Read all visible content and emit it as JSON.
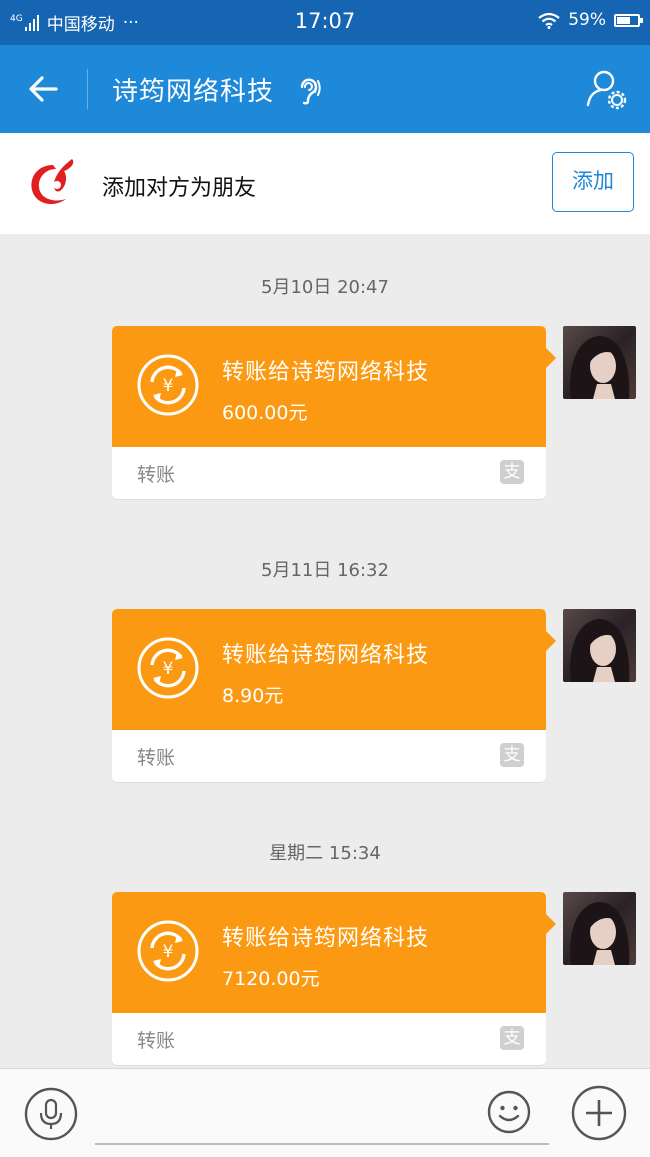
{
  "status_bar": {
    "network": "4G",
    "carrier": "中国移动",
    "more": "···",
    "time": "17:07",
    "battery_percent": "59%",
    "battery_level": 0.59
  },
  "header": {
    "title": "诗筠网络科技"
  },
  "add_friend": {
    "prompt": "添加对方为朋友",
    "button_label": "添加"
  },
  "messages": [
    {
      "timestamp": "5月10日 20:47",
      "title": "转账给诗筠网络科技",
      "amount": "600.00元",
      "label": "转账",
      "source_icon": "支"
    },
    {
      "timestamp": "5月11日 16:32",
      "title": "转账给诗筠网络科技",
      "amount": "8.90元",
      "label": "转账",
      "source_icon": "支"
    },
    {
      "timestamp": "星期二 15:34",
      "title": "转账给诗筠网络科技",
      "amount": "7120.00元",
      "label": "转账",
      "source_icon": "支"
    }
  ],
  "input_bar": {
    "placeholder": ""
  },
  "colors": {
    "status_bar": "#1565b3",
    "title_bar": "#1e88d9",
    "transfer_card": "#fb9a12",
    "background": "#ececec"
  }
}
